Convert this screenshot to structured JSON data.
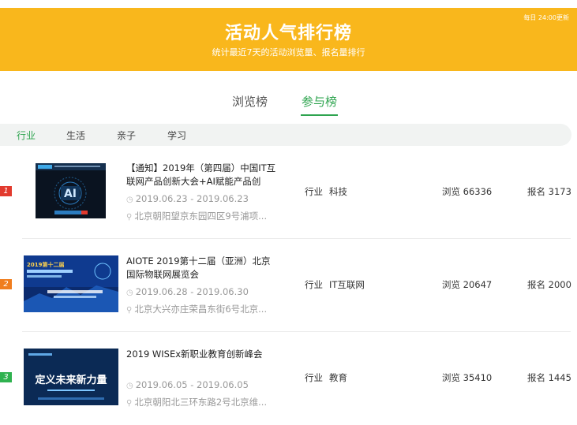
{
  "header": {
    "title": "活动人气排行榜",
    "subtitle": "统计最近7天的活动浏览量、报名量排行",
    "update_note": "每日 24:00更新"
  },
  "tabs": [
    {
      "label": "浏览榜",
      "active": false
    },
    {
      "label": "参与榜",
      "active": true
    }
  ],
  "categories": [
    {
      "label": "行业",
      "active": true
    },
    {
      "label": "生活",
      "active": false
    },
    {
      "label": "亲子",
      "active": false
    },
    {
      "label": "学习",
      "active": false
    }
  ],
  "colors": {
    "banner": "#f9b71c",
    "accent": "#2ea44f",
    "rank1": "#e23a2e",
    "rank2": "#f07d1e",
    "rank3": "#2fb24f"
  },
  "events": [
    {
      "rank": "1",
      "title": "【通知】2019年（第四届）中国IT互联网产品创新大会+AI赋能产品创",
      "date": "2019.06.23 - 2019.06.23",
      "address": "北京朝阳望京东园四区9号浦项...",
      "category": "行业",
      "tag": "科技",
      "views_label": "浏览 66336",
      "signups_label": "报名 3173",
      "thumb_text": "AI"
    },
    {
      "rank": "2",
      "title": "AIOTE 2019第十二届（亚洲）北京国际物联网展览会",
      "date": "2019.06.28 - 2019.06.30",
      "address": "北京大兴亦庄荣昌东街6号北京...",
      "category": "行业",
      "tag": "IT互联网",
      "views_label": "浏览 20647",
      "signups_label": "报名 2000",
      "thumb_text": "2019第十二届"
    },
    {
      "rank": "3",
      "title": "2019 WISEx新职业教育创新峰会",
      "date": "2019.06.05 - 2019.06.05",
      "address": "北京朝阳北三环东路2号北京维...",
      "category": "行业",
      "tag": "教育",
      "views_label": "浏览 35410",
      "signups_label": "报名 1445",
      "thumb_text": "定义未来新力量"
    }
  ]
}
